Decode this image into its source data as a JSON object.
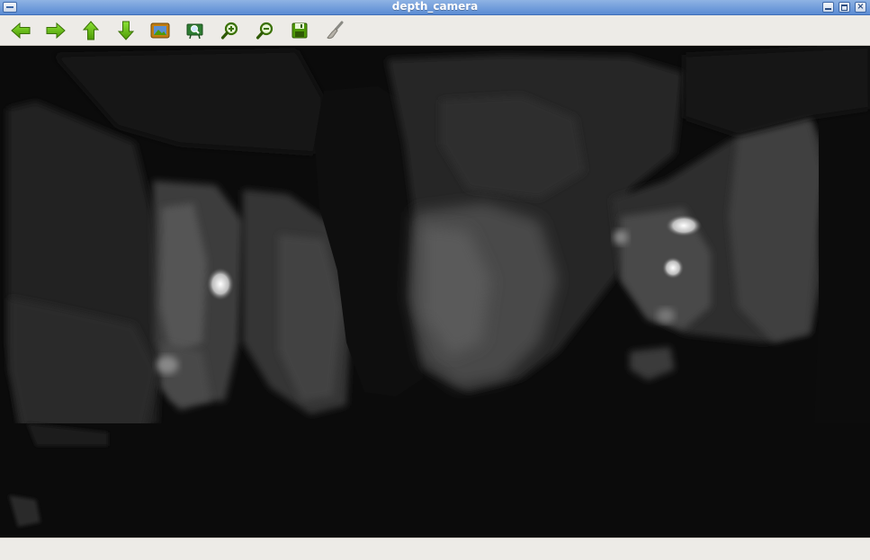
{
  "window": {
    "title": "depth_camera"
  },
  "toolbar": {
    "buttons": [
      {
        "name": "pan-left",
        "icon": "arrow-left-icon"
      },
      {
        "name": "pan-right",
        "icon": "arrow-right-icon"
      },
      {
        "name": "pan-up",
        "icon": "arrow-up-icon"
      },
      {
        "name": "pan-down",
        "icon": "arrow-down-icon"
      },
      {
        "name": "reset-zoom",
        "icon": "picture-icon"
      },
      {
        "name": "zoom-area",
        "icon": "zoom-region-icon"
      },
      {
        "name": "zoom-in",
        "icon": "zoom-in-icon"
      },
      {
        "name": "zoom-out",
        "icon": "zoom-out-icon"
      },
      {
        "name": "save-image",
        "icon": "save-icon"
      },
      {
        "name": "properties",
        "icon": "brush-icon"
      }
    ],
    "accent_color": "#4e9a06"
  },
  "image_view": {
    "content": "depth map",
    "colormap": "grayscale"
  },
  "statusbar": {
    "text": ""
  }
}
